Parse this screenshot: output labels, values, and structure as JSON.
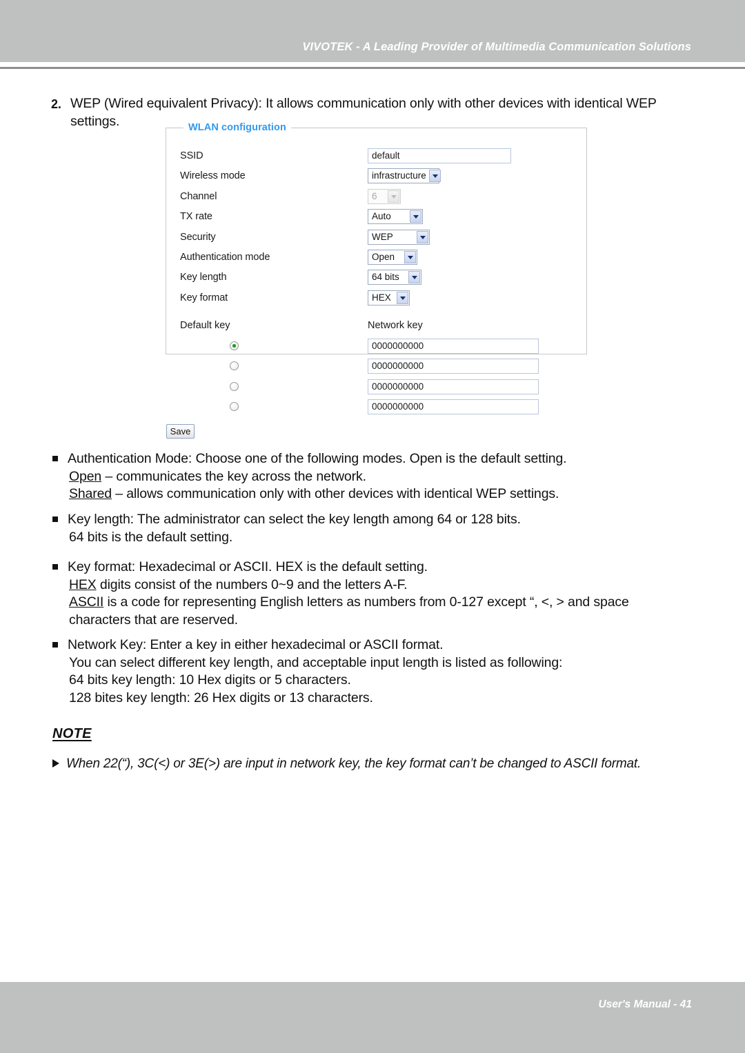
{
  "header": {
    "title": "VIVOTEK - A Leading Provider of Multimedia Communication Solutions"
  },
  "item2": {
    "number": "2.",
    "line1": "WEP (Wired equivalent Privacy): It allows communication only with other devices with identical WEP",
    "line2": "settings."
  },
  "wlan_form": {
    "legend": "WLAN configuration",
    "rows": [
      {
        "label": "SSID",
        "type": "text",
        "value": "default",
        "disabled": false
      },
      {
        "label": "Wireless mode",
        "type": "select",
        "value": "infrastructure",
        "disabled": false
      },
      {
        "label": "Channel",
        "type": "select",
        "value": "6",
        "disabled": true
      },
      {
        "label": "TX rate",
        "type": "select",
        "value": "Auto",
        "disabled": false
      },
      {
        "label": "Security",
        "type": "select",
        "value": "WEP",
        "disabled": false
      },
      {
        "label": "Authentication mode",
        "type": "select",
        "value": "Open",
        "disabled": false
      },
      {
        "label": "Key length",
        "type": "select",
        "value": "64 bits",
        "disabled": false
      },
      {
        "label": "Key format",
        "type": "select",
        "value": "HEX",
        "disabled": false
      }
    ],
    "default_key_header": "Default key",
    "network_key_header": "Network key",
    "keys": [
      {
        "selected": true,
        "value": "0000000000"
      },
      {
        "selected": false,
        "value": "0000000000"
      },
      {
        "selected": false,
        "value": "0000000000"
      },
      {
        "selected": false,
        "value": "0000000000"
      }
    ],
    "save_label": "Save"
  },
  "bullets": {
    "auth": {
      "line1": "Authentication Mode: Choose one of the following modes. Open is the default setting.",
      "term1": "Open",
      "rest1": " – communicates the key across the network.",
      "term2": "Shared",
      "rest2": " – allows communication only with other devices with identical WEP settings."
    },
    "keylength": {
      "line1": "Key length: The administrator can select the key length among 64 or 128 bits.",
      "line2": "64 bits is the default setting."
    },
    "keyformat": {
      "line1": "Key format: Hexadecimal or ASCII. HEX is the default setting.",
      "term1": "HEX",
      "rest1": " digits consist of the numbers 0~9 and the letters A-F.",
      "term2": "ASCII",
      "rest2": " is a code for representing English letters as numbers from 0-127 except “, <, > and space",
      "line4": "characters that are reserved."
    },
    "networkkey": {
      "line1": "Network Key: Enter a key in either hexadecimal or ASCII format.",
      "line2": "You can select different key length,  and acceptable input length is listed as following:",
      "line3": "64 bits key length: 10 Hex digits or 5 characters.",
      "line4": "128 bites key length: 26 Hex digits or 13 characters."
    }
  },
  "note": {
    "heading": "NOTE",
    "text": "When 22(“), 3C(<) or 3E(>) are input in network key, the key format can’t be changed to ASCII format."
  },
  "footer": {
    "text": "User's Manual - 41"
  },
  "colors": {
    "band_gray": "#bfc1c0",
    "rule_gray": "#8d8f8e",
    "legend_blue": "#3399ee",
    "radio_green": "#17a017"
  }
}
